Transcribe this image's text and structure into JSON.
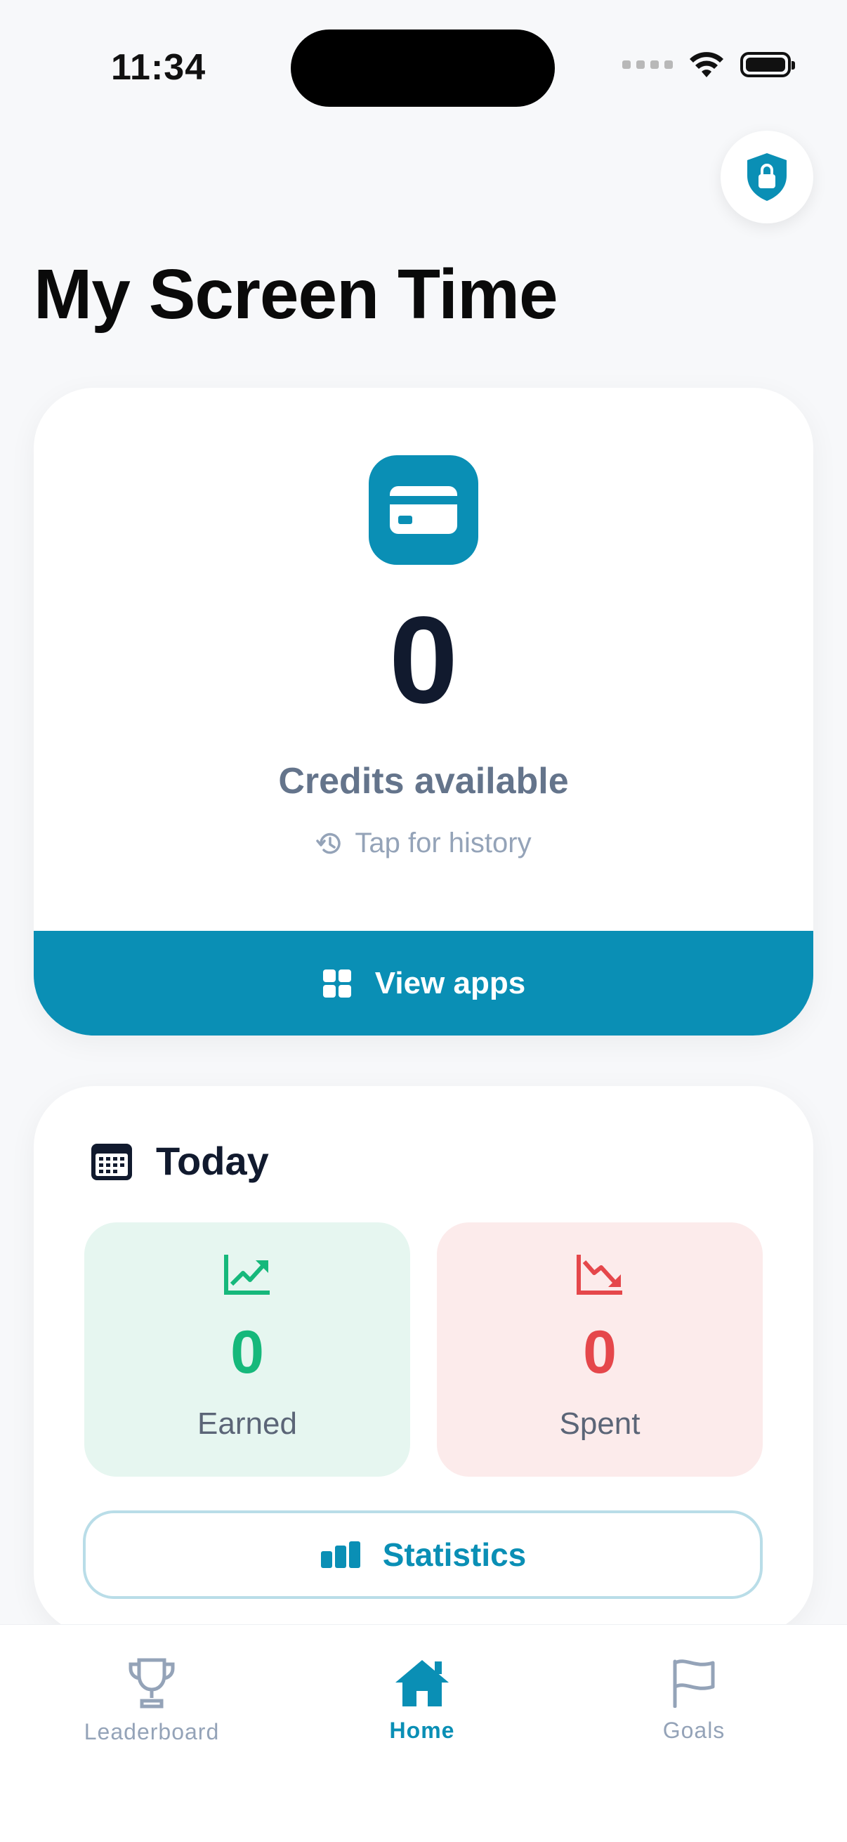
{
  "status_bar": {
    "time": "11:34"
  },
  "header": {
    "title": "My Screen Time",
    "lock_icon": "shield-lock-icon"
  },
  "credits": {
    "value": "0",
    "label": "Credits available",
    "history_label": "Tap for history",
    "view_apps_label": "View apps"
  },
  "today": {
    "title": "Today",
    "earned": {
      "value": "0",
      "label": "Earned"
    },
    "spent": {
      "value": "0",
      "label": "Spent"
    },
    "statistics_label": "Statistics"
  },
  "tabs": [
    {
      "label": "Leaderboard",
      "icon": "trophy-icon",
      "active": false
    },
    {
      "label": "Home",
      "icon": "home-icon",
      "active": true
    },
    {
      "label": "Goals",
      "icon": "flag-icon",
      "active": false
    }
  ],
  "colors": {
    "accent": "#0a8fb5",
    "earned": "#16b87b",
    "spent": "#e5474b",
    "inactive_tab": "#94a3b8"
  }
}
